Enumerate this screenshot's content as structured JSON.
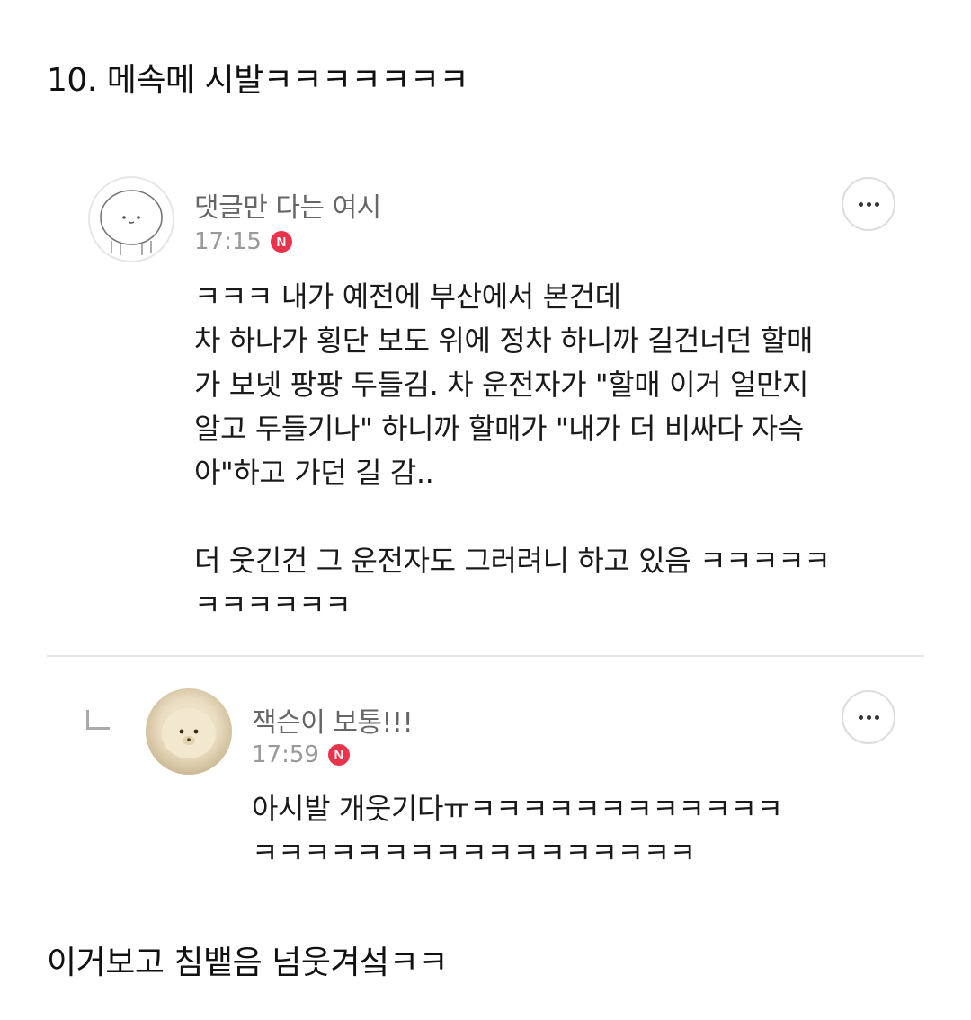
{
  "post": {
    "heading": "10. 메속메 시발ㅋㅋㅋㅋㅋㅋㅋ",
    "footer": "이거보고 침뱉음 넘웃겨섴ㅋㅋ"
  },
  "comments": [
    {
      "nickname": "댓글만 다는 여시",
      "time": "17:15",
      "badge": "N",
      "avatar_icon": "cartoon-face-avatar",
      "more_icon": "more-dots-icon",
      "lines": [
        "ㅋㅋㅋ 내가 예전에 부산에서 본건데",
        "차 하나가 횡단 보도 위에 정차 하니까 길건너던 할매",
        "가 보넷 팡팡 두들김. 차 운전자가 \"할매 이거 얼만지",
        "알고 두들기나\" 하니까 할매가 \"내가 더 비싸다 자슥",
        "아\"하고 가던 길 감..",
        "더 웃긴건 그 운전자도 그러려니 하고 있음 ㅋㅋㅋㅋㅋ",
        "ㅋㅋㅋㅋㅋㅋ"
      ]
    },
    {
      "nickname": "잭슨이 보통!!!",
      "time": "17:59",
      "badge": "N",
      "avatar_icon": "teddy-bear-avatar",
      "more_icon": "more-dots-icon",
      "reply_icon": "reply-arrow-icon",
      "lines": [
        "아시발 개웃기다ㅠㅋㅋㅋㅋㅋㅋㅋㅋㅋㅋㅋㅋ",
        "ㅋㅋㅋㅋㅋㅋㅋㅋㅋㅋㅋㅋㅋㅋㅋㅋㅋ"
      ]
    }
  ],
  "colors": {
    "badge": "#e8334a",
    "nickname": "#666666",
    "time": "#999999",
    "divider": "#e6e6e6"
  }
}
